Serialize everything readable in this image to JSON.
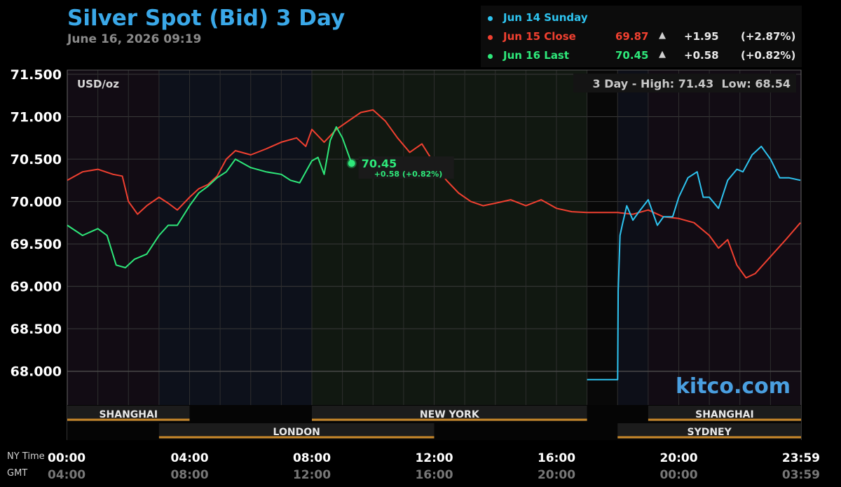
{
  "header": {
    "title": "Silver Spot (Bid) 3 Day",
    "subtitle": "June 16, 2026 09:19"
  },
  "legend": [
    {
      "name": "Jun 14 Sunday",
      "value": "",
      "arrow": "",
      "change": "",
      "pct": "",
      "color": "#2ec4f0"
    },
    {
      "name": "Jun 15 Close",
      "value": "69.87",
      "arrow": "▲",
      "change": "+1.95",
      "pct": "(+2.87%)",
      "color": "#f04030"
    },
    {
      "name": "Jun 16 Last",
      "value": "70.45",
      "arrow": "▲",
      "change": "+0.58",
      "pct": "(+0.82%)",
      "color": "#2ee87a"
    }
  ],
  "chart_data": {
    "type": "line",
    "unit_label": "USD/oz",
    "high_low_label": "3 Day - High: 71.43  Low: 68.54",
    "watermark": "kitco.com",
    "ylim": [
      67.6,
      71.55
    ],
    "yticks": [
      "71.500",
      "71.000",
      "70.500",
      "70.000",
      "69.500",
      "69.000",
      "68.500",
      "68.000"
    ],
    "ytick_values": [
      71.5,
      71.0,
      70.5,
      70.0,
      69.5,
      69.0,
      68.5,
      68.0
    ],
    "x_range_hours": [
      0,
      24
    ],
    "xticks_ny": [
      "00:00",
      "04:00",
      "08:00",
      "12:00",
      "16:00",
      "20:00",
      "23:59"
    ],
    "xticks_gmt": [
      "04:00",
      "08:00",
      "12:00",
      "16:00",
      "20:00",
      "00:00",
      "03:59"
    ],
    "xtick_hours": [
      0,
      4,
      8,
      12,
      16,
      20,
      23.98
    ],
    "axis_row_labels": {
      "ny": "NY Time",
      "gmt": "GMT"
    },
    "sessions": [
      {
        "name": "SHANGHAI",
        "start": 0,
        "end": 4,
        "row": 1
      },
      {
        "name": "NEW YORK",
        "start": 8,
        "end": 17,
        "row": 1
      },
      {
        "name": "SHANGHAI",
        "start": 19,
        "end": 24,
        "row": 1
      },
      {
        "name": "LONDON",
        "start": 3,
        "end": 12,
        "row": 2
      },
      {
        "name": "SYDNEY",
        "start": 18,
        "end": 24,
        "row": 2
      }
    ],
    "last_point": {
      "x": 9.3,
      "y": 70.45,
      "label": "70.45",
      "sublabel": "+0.58 (+0.82%)"
    },
    "series": [
      {
        "name": "Jun 15 Close",
        "color": "#f04030",
        "x": [
          0,
          0.5,
          1,
          1.5,
          1.8,
          2.0,
          2.3,
          2.6,
          3.0,
          3.3,
          3.6,
          4.0,
          4.3,
          4.6,
          4.9,
          5.2,
          5.5,
          6.0,
          6.5,
          7.0,
          7.5,
          7.8,
          8.0,
          8.4,
          8.8,
          9.2,
          9.6,
          10.0,
          10.4,
          10.8,
          11.2,
          11.6,
          12.0,
          12.4,
          12.8,
          13.2,
          13.6,
          14.0,
          14.5,
          15.0,
          15.5,
          16.0,
          16.5,
          17.0,
          17.5,
          18.0,
          18.5,
          19.0,
          19.5,
          20.0,
          20.5,
          21.0,
          21.3,
          21.6,
          21.9,
          22.2,
          22.5,
          23.0,
          23.5,
          23.98
        ],
        "y": [
          70.25,
          70.35,
          70.38,
          70.32,
          70.3,
          70.0,
          69.85,
          69.95,
          70.05,
          69.98,
          69.9,
          70.05,
          70.15,
          70.2,
          70.3,
          70.5,
          70.6,
          70.55,
          70.62,
          70.7,
          70.75,
          70.65,
          70.85,
          70.7,
          70.85,
          70.95,
          71.05,
          71.08,
          70.95,
          70.75,
          70.58,
          70.68,
          70.45,
          70.25,
          70.1,
          70.0,
          69.95,
          69.98,
          70.02,
          69.95,
          70.02,
          69.92,
          69.88,
          69.87,
          69.87,
          69.87,
          69.85,
          69.9,
          69.82,
          69.8,
          69.75,
          69.6,
          69.45,
          69.55,
          69.25,
          69.1,
          69.15,
          69.35,
          69.55,
          69.75
        ]
      },
      {
        "name": "Jun 16 Last",
        "color": "#2ee87a",
        "x": [
          0,
          0.5,
          1,
          1.3,
          1.6,
          1.9,
          2.2,
          2.6,
          3.0,
          3.3,
          3.6,
          4.0,
          4.3,
          4.6,
          4.9,
          5.2,
          5.5,
          6.0,
          6.5,
          7.0,
          7.3,
          7.6,
          8.0,
          8.2,
          8.4,
          8.6,
          8.8,
          9.0,
          9.3
        ],
        "y": [
          69.72,
          69.6,
          69.68,
          69.6,
          69.25,
          69.22,
          69.32,
          69.38,
          69.6,
          69.72,
          69.72,
          69.95,
          70.1,
          70.18,
          70.28,
          70.35,
          70.5,
          70.4,
          70.35,
          70.32,
          70.25,
          70.22,
          70.48,
          70.52,
          70.32,
          70.72,
          70.88,
          70.75,
          70.45
        ]
      },
      {
        "name": "Jun 14 Sunday",
        "color": "#2ec4f0",
        "x": [
          17.0,
          18.0,
          18.02,
          18.08,
          18.15,
          18.3,
          18.5,
          18.7,
          19.0,
          19.3,
          19.5,
          19.8,
          20.0,
          20.3,
          20.6,
          20.8,
          21.0,
          21.3,
          21.6,
          21.9,
          22.1,
          22.4,
          22.7,
          23.0,
          23.3,
          23.6,
          23.98
        ],
        "y": [
          67.9,
          67.9,
          68.95,
          69.6,
          69.72,
          69.95,
          69.78,
          69.88,
          70.02,
          69.72,
          69.82,
          69.82,
          70.05,
          70.28,
          70.35,
          70.05,
          70.05,
          69.92,
          70.25,
          70.38,
          70.35,
          70.55,
          70.65,
          70.5,
          70.28,
          70.28,
          70.25
        ]
      }
    ]
  }
}
